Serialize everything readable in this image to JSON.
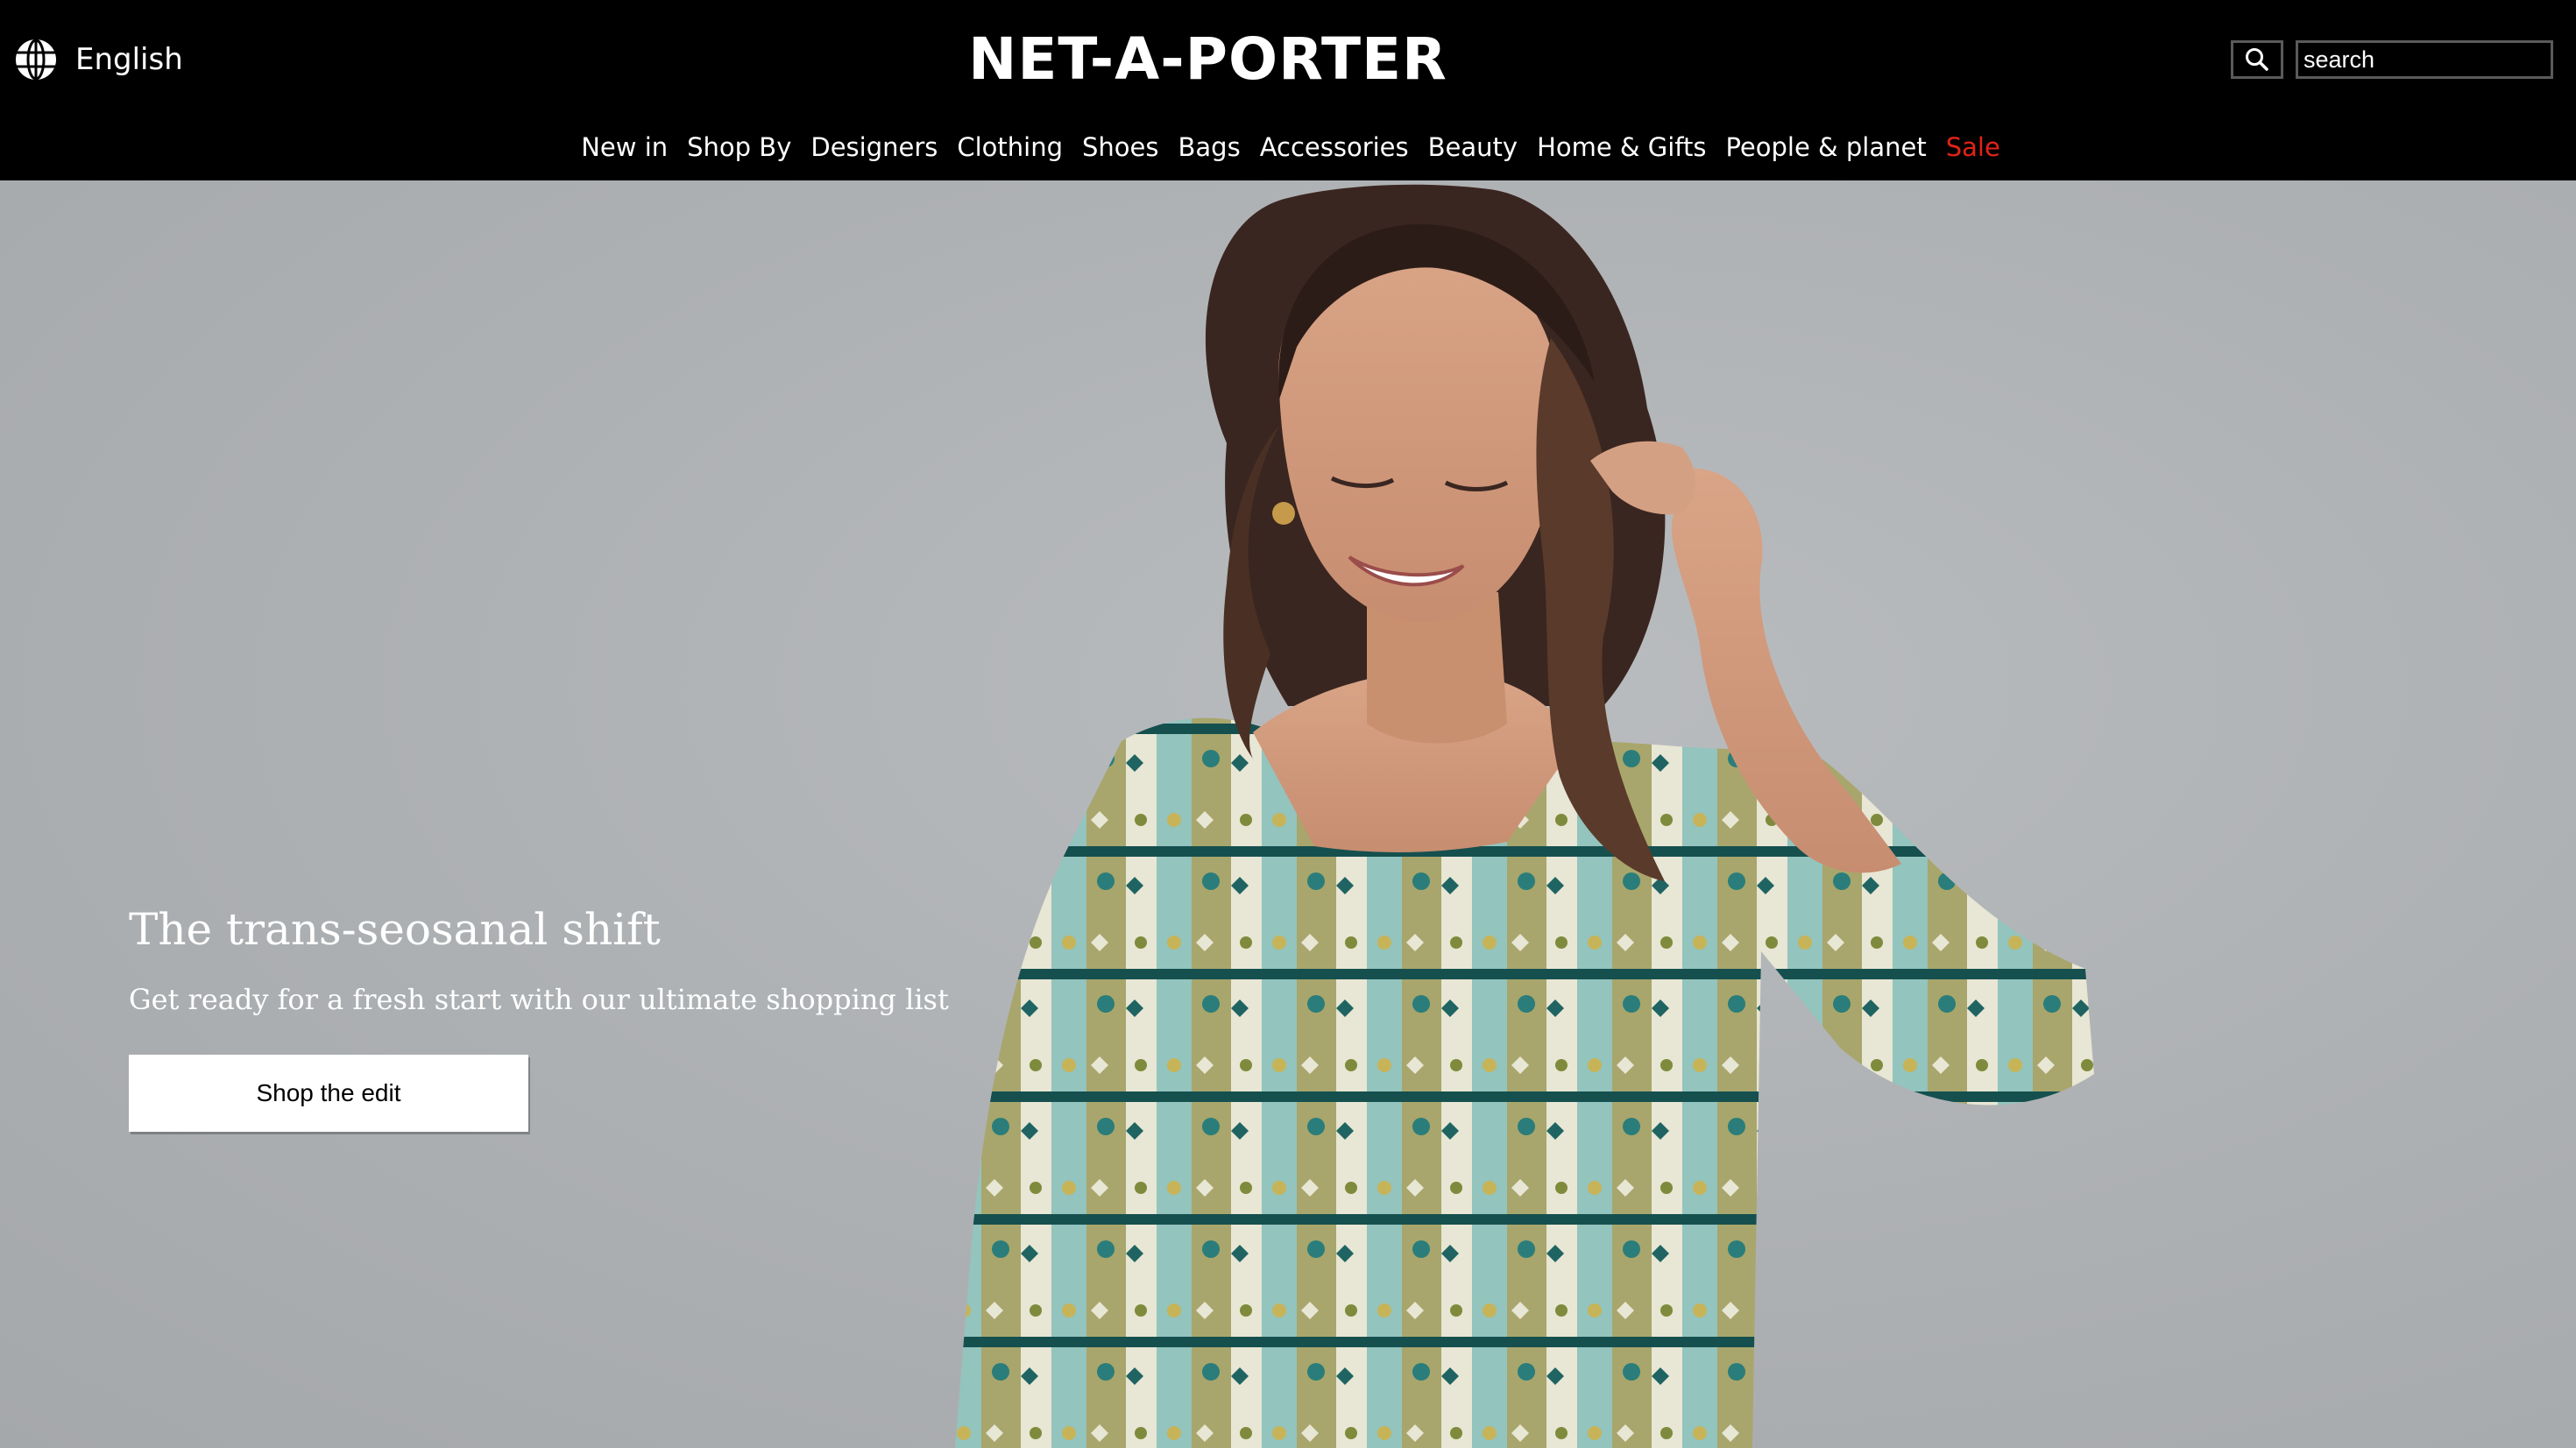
{
  "header": {
    "language_label": "English",
    "brand": "NET-A-PORTER",
    "search_placeholder": "search"
  },
  "nav": {
    "items": [
      "New in",
      "Shop By",
      "Designers",
      "Clothing",
      "Shoes",
      "Bags",
      "Accessories",
      "Beauty",
      "Home & Gifts",
      "People & planet",
      "Sale"
    ]
  },
  "hero": {
    "title": "The trans-seosanal shift",
    "subtitle": "Get ready for a fresh start with our ultimate shopping list",
    "cta_label": "Shop the edit"
  },
  "colors": {
    "header_bg": "#000000",
    "sale": "#e32219",
    "hero_bg": "#adb0b3",
    "cta_bg": "#ffffff"
  },
  "icons": {
    "language": "globe-icon",
    "search": "search-icon"
  }
}
